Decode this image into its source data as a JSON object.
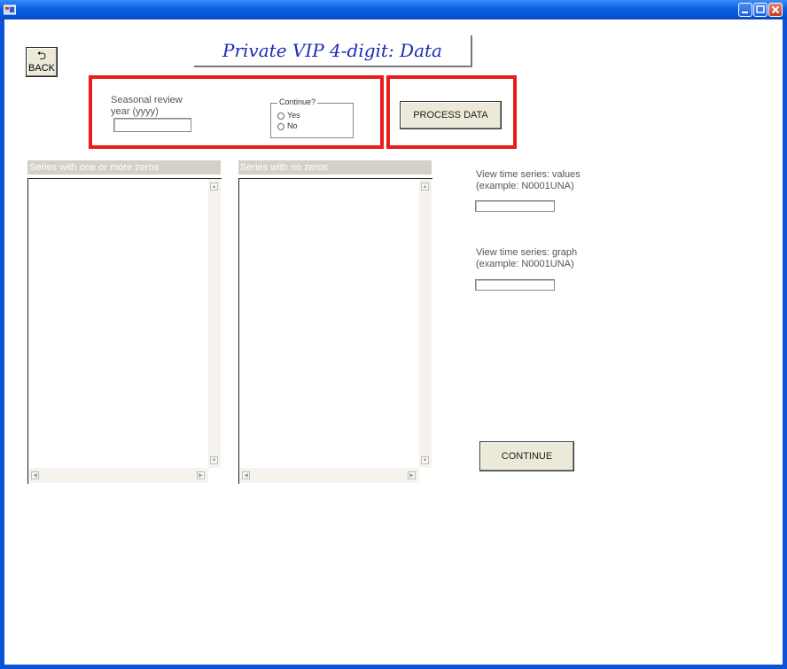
{
  "window": {
    "controls": [
      {
        "name": "minimize",
        "icon": "minimize-icon"
      },
      {
        "name": "maximize",
        "icon": "maximize-icon"
      },
      {
        "name": "close",
        "icon": "close-icon"
      }
    ]
  },
  "back_button": {
    "label": "BACK",
    "icon": "back-arrow-icon"
  },
  "title": "Private VIP 4-digit: Data",
  "review_year": {
    "label": "Seasonal review year (yyyy)",
    "value": ""
  },
  "continue_group": {
    "legend": "Continue?",
    "options": [
      "Yes",
      "No"
    ],
    "selected": null
  },
  "process_button": {
    "label": "PROCESS DATA"
  },
  "lists": {
    "zeros": {
      "header": "Series with one or more zeros",
      "items": []
    },
    "no_zeros": {
      "header": "Series with no zeros",
      "items": []
    }
  },
  "view_values": {
    "label": "View time series: values (example: N0001UNA)",
    "value": ""
  },
  "view_graph": {
    "label": "View time series: graph (example: N0001UNA)",
    "value": ""
  },
  "continue_button": {
    "label": "CONTINUE"
  },
  "accent_colors": {
    "titlebar": "#0a5fe0",
    "highlight": "#ea1b1b",
    "title_text": "#1a2bb6"
  }
}
